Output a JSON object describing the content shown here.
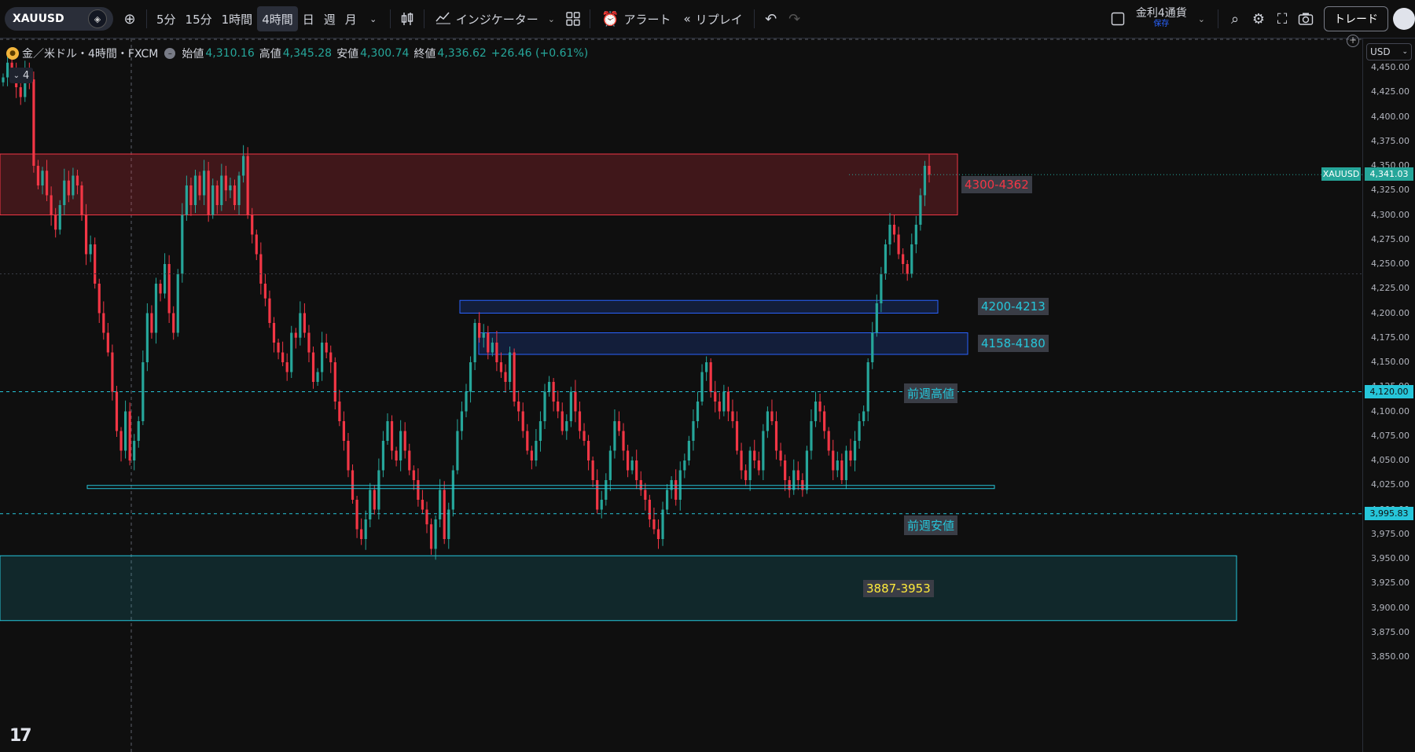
{
  "toolbar": {
    "symbol": "XAUUSD",
    "timeframes": [
      "5分",
      "15分",
      "1時間",
      "4時間",
      "日",
      "週",
      "月"
    ],
    "active_timeframe": "4時間",
    "indicators_label": "インジケーター",
    "alert_label": "アラート",
    "replay_label": "リプレイ",
    "layout_name": "金利4通貨",
    "layout_status": "保存",
    "trade_label": "トレード"
  },
  "legend": {
    "title": "金／米ドル・4時間・FXCM",
    "open_label": "始値",
    "open": "4,310.16",
    "high_label": "高値",
    "high": "4,345.28",
    "low_label": "安値",
    "low": "4,300.74",
    "close_label": "終値",
    "close": "4,336.62",
    "change": "+26.46 (+0.61%)",
    "collapse_count": "4"
  },
  "price_axis": {
    "currency": "USD",
    "ticks": [
      "4,450.00",
      "4,425.00",
      "4,400.00",
      "4,375.00",
      "4,350.00",
      "4,325.00",
      "4,300.00",
      "4,275.00",
      "4,250.00",
      "4,225.00",
      "4,200.00",
      "4,175.00",
      "4,150.00",
      "4,125.00",
      "4,100.00",
      "4,075.00",
      "4,050.00",
      "4,025.00",
      "4,000.00",
      "3,975.00",
      "3,950.00",
      "3,925.00",
      "3,900.00",
      "3,875.00",
      "3,850.00"
    ],
    "current_label": "XAUUSD",
    "current_price": "4,341.03",
    "high_line_price": "4,120.00",
    "low_line_price": "3,995.83"
  },
  "zones": [
    {
      "label": "4300-4362",
      "low": 4300,
      "high": 4362,
      "color": "#f23645"
    },
    {
      "label": "4200-4213",
      "low": 4200,
      "high": 4213,
      "color": "#2962ff"
    },
    {
      "label": "4158-4180",
      "low": 4158,
      "high": 4180,
      "color": "#2962ff"
    },
    {
      "label": "3887-3953",
      "low": 3887,
      "high": 3953,
      "color": "#26c6da"
    }
  ],
  "levels": {
    "prev_week_high_label": "前週高値",
    "prev_week_high": 4120,
    "prev_week_low_label": "前週安値",
    "prev_week_low": 3995.83,
    "support_line": 4023
  },
  "colors": {
    "up": "#26a69a",
    "down": "#f23645",
    "bg": "#0f0f0f"
  },
  "chart_data": {
    "type": "candlestick",
    "title": "金／米ドル・4時間・FXCM",
    "ylim": [
      3850,
      4470
    ],
    "series": [
      {
        "values": [
          4440,
          4455,
          4448,
          4430,
          4420,
          4445,
          4438,
          4350,
          4330,
          4345,
          4320,
          4300,
          4285,
          4310,
          4335,
          4320,
          4340,
          4330,
          4300,
          4260,
          4270,
          4230,
          4200,
          4180,
          4160,
          4120,
          4080,
          4060,
          4100,
          4050,
          4070,
          4090,
          4150,
          4200,
          4180,
          4230,
          4220,
          4250,
          4200,
          4180,
          4240,
          4300,
          4330,
          4310,
          4340,
          4320,
          4345,
          4300,
          4330,
          4310,
          4340,
          4325,
          4330,
          4310,
          4340,
          4360,
          4300,
          4280,
          4260,
          4230,
          4215,
          4190,
          4170,
          4160,
          4150,
          4140,
          4180,
          4175,
          4200,
          4180,
          4160,
          4130,
          4140,
          4170,
          4160,
          4150,
          4110,
          4090,
          4070,
          4040,
          4010,
          3980,
          3970,
          3990,
          4020,
          4000,
          4040,
          4070,
          4090,
          4060,
          4050,
          4080,
          4060,
          4040,
          4030,
          4010,
          4000,
          3985,
          3960,
          3990,
          4020,
          3970,
          4000,
          4040,
          4080,
          4100,
          4120,
          4150,
          4190,
          4175,
          4180,
          4160,
          4170,
          4150,
          4140,
          4130,
          4160,
          4110,
          4100,
          4080,
          4060,
          4050,
          4070,
          4090,
          4120,
          4130,
          4110,
          4100,
          4080,
          4090,
          4120,
          4100,
          4080,
          4070,
          4050,
          4030,
          4000,
          4010,
          4030,
          4060,
          4090,
          4080,
          4060,
          4040,
          4050,
          4030,
          4020,
          4010,
          3990,
          3980,
          3970,
          4000,
          4020,
          4030,
          4010,
          4040,
          4050,
          4070,
          4090,
          4110,
          4140,
          4150,
          4120,
          4110,
          4100,
          4120,
          4100,
          4090,
          4060,
          4040,
          4030,
          4060,
          4050,
          4040,
          4080,
          4100,
          4090,
          4060,
          4050,
          4030,
          4020,
          4040,
          4030,
          4020,
          4060,
          4090,
          4110,
          4100,
          4080,
          4060,
          4040,
          4050,
          4030,
          4060,
          4050,
          4070,
          4090,
          4100,
          4150,
          4180,
          4210,
          4240,
          4270,
          4290,
          4280,
          4260,
          4250,
          4240,
          4270,
          4290,
          4320,
          4350,
          4341
        ]
      }
    ]
  }
}
